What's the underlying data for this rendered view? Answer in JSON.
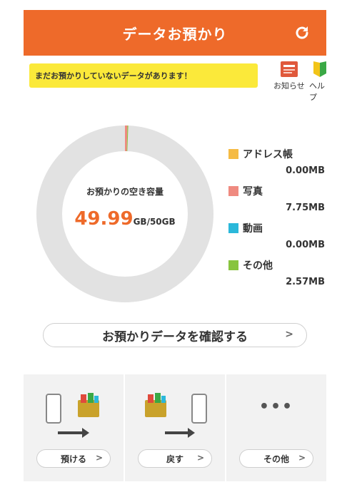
{
  "header": {
    "title": "データお預かり"
  },
  "notice": {
    "text": "まだお預かりしていないデータがあります！"
  },
  "buttons": {
    "news_label": "お知らせ",
    "help_label": "ヘルプ"
  },
  "capacity": {
    "label": "お預かりの空き容量",
    "free_value": "49.99",
    "unit": "GB/50GB"
  },
  "chart_data": {
    "type": "pie",
    "title": "",
    "total_mb": 51200,
    "series": [
      {
        "name": "アドレス帳",
        "value_mb": 0.0,
        "label": "0.00MB",
        "color": "#f5bb44"
      },
      {
        "name": "写真",
        "value_mb": 7.75,
        "label": "7.75MB",
        "color": "#ef8a80"
      },
      {
        "name": "動画",
        "value_mb": 0.0,
        "label": "0.00MB",
        "color": "#2bb8da"
      },
      {
        "name": "その他",
        "value_mb": 2.57,
        "label": "2.57MB",
        "color": "#88c43e"
      }
    ],
    "free_color": "#e2e2e2"
  },
  "confirm": {
    "label": "お預かりデータを確認する",
    "chevron": ">"
  },
  "actions": [
    {
      "label": "預ける",
      "chevron": ">"
    },
    {
      "label": "戻す",
      "chevron": ">"
    },
    {
      "label": "その他",
      "chevron": ">",
      "icon": "•••"
    }
  ]
}
